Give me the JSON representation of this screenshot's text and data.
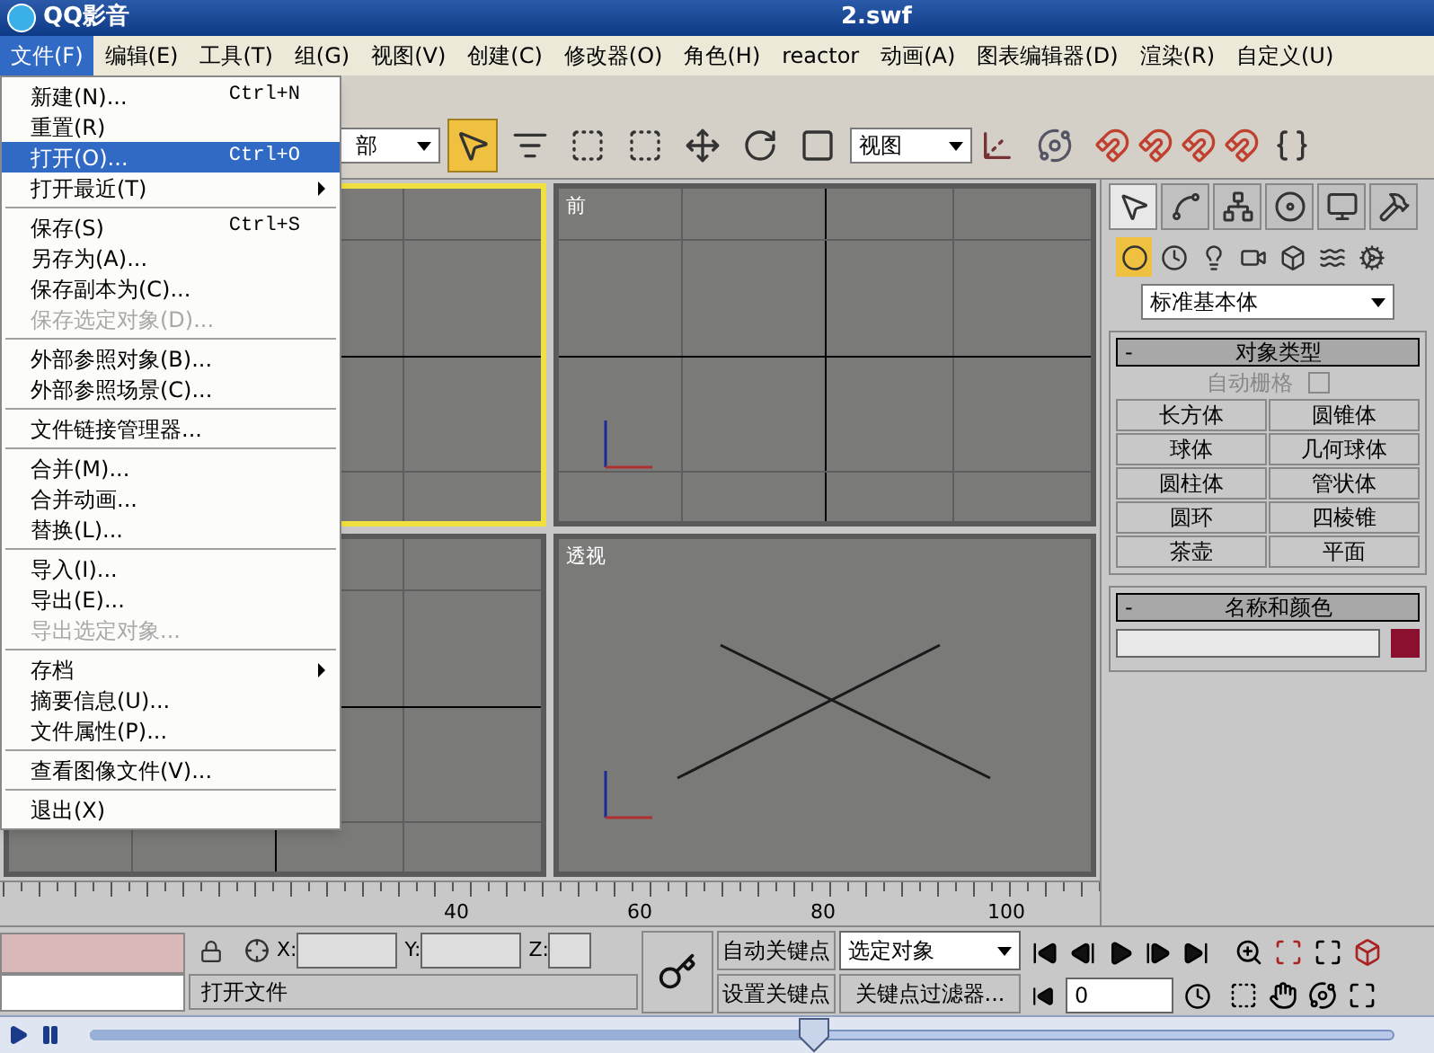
{
  "title_bar": {
    "app_name": "QQ影音",
    "file_name": "2.swf"
  },
  "menu_bar": [
    {
      "label": "文件(F)",
      "selected": true
    },
    {
      "label": "编辑(E)",
      "selected": false
    },
    {
      "label": "工具(T)",
      "selected": false
    },
    {
      "label": "组(G)",
      "selected": false
    },
    {
      "label": "视图(V)",
      "selected": false
    },
    {
      "label": "创建(C)",
      "selected": false
    },
    {
      "label": "修改器(O)",
      "selected": false
    },
    {
      "label": "角色(H)",
      "selected": false
    },
    {
      "label": "reactor",
      "selected": false
    },
    {
      "label": "动画(A)",
      "selected": false
    },
    {
      "label": "图表编辑器(D)",
      "selected": false
    },
    {
      "label": "渲染(R)",
      "selected": false
    },
    {
      "label": "自定义(U)",
      "selected": false
    }
  ],
  "toolbar": {
    "selection_dropdown": "部",
    "tools": [
      {
        "selected": true
      },
      {
        "selected": false
      },
      {
        "selected": false
      },
      {
        "selected": false
      },
      {
        "selected": false
      },
      {
        "selected": false
      },
      {
        "selected": false
      }
    ],
    "coordinate_dropdown": "视图"
  },
  "file_menu": [
    [
      {
        "label": "新建(N)...",
        "shortcut": "Ctrl+N",
        "disabled": false,
        "selected": false,
        "submenu": false
      },
      {
        "label": "重置(R)",
        "disabled": false,
        "selected": false,
        "submenu": false
      },
      {
        "label": "打开(O)...",
        "shortcut": "Ctrl+O",
        "disabled": false,
        "selected": true,
        "submenu": false
      },
      {
        "label": "打开最近(T)",
        "disabled": false,
        "selected": false,
        "submenu": true
      }
    ],
    [
      {
        "label": "保存(S)",
        "shortcut": "Ctrl+S",
        "disabled": false,
        "selected": false,
        "submenu": false
      },
      {
        "label": "另存为(A)...",
        "disabled": false,
        "selected": false,
        "submenu": false
      },
      {
        "label": "保存副本为(C)...",
        "disabled": false,
        "selected": false,
        "submenu": false
      },
      {
        "label": "保存选定对象(D)...",
        "disabled": true,
        "selected": false,
        "submenu": false
      }
    ],
    [
      {
        "label": "外部参照对象(B)...",
        "disabled": false,
        "selected": false,
        "submenu": false
      },
      {
        "label": "外部参照场景(C)...",
        "disabled": false,
        "selected": false,
        "submenu": false
      }
    ],
    [
      {
        "label": "文件链接管理器...",
        "disabled": false,
        "selected": false,
        "submenu": false
      }
    ],
    [
      {
        "label": "合并(M)...",
        "disabled": false,
        "selected": false,
        "submenu": false
      },
      {
        "label": "合并动画...",
        "disabled": false,
        "selected": false,
        "submenu": false
      },
      {
        "label": "替换(L)...",
        "disabled": false,
        "selected": false,
        "submenu": false
      }
    ],
    [
      {
        "label": "导入(I)...",
        "disabled": false,
        "selected": false,
        "submenu": false
      },
      {
        "label": "导出(E)...",
        "disabled": false,
        "selected": false,
        "submenu": false
      },
      {
        "label": "导出选定对象...",
        "disabled": true,
        "selected": false,
        "submenu": false
      }
    ],
    [
      {
        "label": "存档",
        "disabled": false,
        "selected": false,
        "submenu": true
      },
      {
        "label": "摘要信息(U)...",
        "disabled": false,
        "selected": false,
        "submenu": false
      },
      {
        "label": "文件属性(P)...",
        "disabled": false,
        "selected": false,
        "submenu": false
      }
    ],
    [
      {
        "label": "查看图像文件(V)...",
        "disabled": false,
        "selected": false,
        "submenu": false
      }
    ],
    [
      {
        "label": "退出(X)",
        "disabled": false,
        "selected": false,
        "submenu": false
      }
    ]
  ],
  "viewports": [
    {
      "kind": "top",
      "active": true
    },
    {
      "kind": "front",
      "label": "前",
      "active": false
    },
    {
      "kind": "left",
      "active": false
    },
    {
      "kind": "perspective",
      "label": "透视",
      "active": false
    }
  ],
  "timeline_ruler": [
    "40",
    "60",
    "80",
    "100"
  ],
  "command_panel": {
    "tabs": [
      {
        "selected": true
      },
      {
        "selected": false
      },
      {
        "selected": false
      },
      {
        "selected": false
      },
      {
        "selected": false
      },
      {
        "selected": false
      }
    ],
    "categories": [
      {
        "selected": true
      },
      {
        "selected": false
      },
      {
        "selected": false
      },
      {
        "selected": false
      },
      {
        "selected": false
      },
      {
        "selected": false
      },
      {
        "selected": false
      }
    ],
    "type_dropdown": "标准基本体",
    "object_type": {
      "toggle": "-",
      "title": "对象类型",
      "autogrid_label": "自动栅格",
      "autogrid_checked": false,
      "buttons": [
        "长方体",
        "圆锥体",
        "球体",
        "几何球体",
        "圆柱体",
        "管状体",
        "圆环",
        "四棱锥",
        "茶壶",
        "平面"
      ]
    },
    "name_color": {
      "toggle": "-",
      "title": "名称和颜色"
    }
  },
  "bottom_bar": {
    "coord_labels": [
      "X:",
      "Y:",
      "Z:"
    ],
    "auto_key": "自动关键点",
    "set_key": "设置关键点",
    "key_dropdown": "选定对象",
    "key_filters": "关键点过滤器...",
    "frame": "0",
    "status": "打开文件"
  },
  "player": {
    "level": 0.555
  }
}
